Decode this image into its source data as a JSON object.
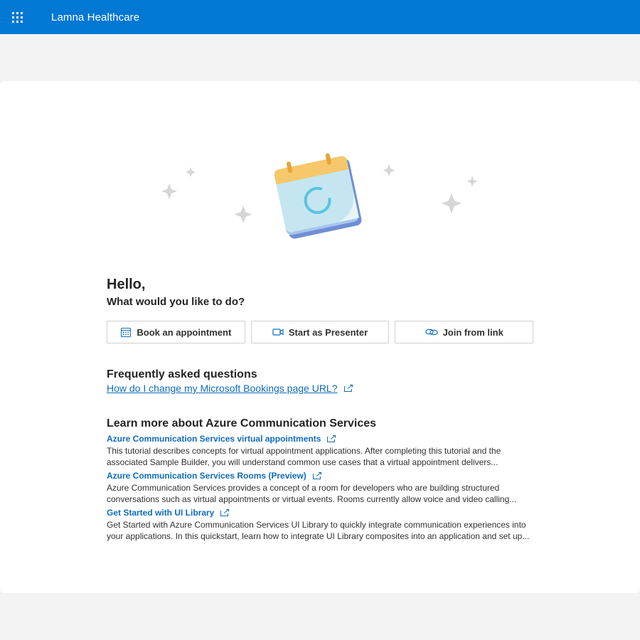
{
  "header": {
    "app_title": "Lamna Healthcare",
    "background": "#0078d4"
  },
  "main": {
    "greeting": "Hello,",
    "prompt": "What would you like to do?",
    "actions": [
      {
        "label": "Book an appointment",
        "icon": "calendar-icon"
      },
      {
        "label": "Start as Presenter",
        "icon": "video-camera-icon"
      },
      {
        "label": "Join from link",
        "icon": "link-icon"
      }
    ]
  },
  "faq": {
    "title": "Frequently asked questions",
    "link": "How do I change my Microsoft Bookings page URL?"
  },
  "learn_more": {
    "title": "Learn more about Azure Communication Services",
    "items": [
      {
        "title": "Azure Communication Services virtual appointments",
        "description": "This tutorial describes concepts for virtual appointment applications. After completing this tutorial and the associated Sample Builder, you will understand common use cases that a virtual appointment delivers..."
      },
      {
        "title": "Azure Communication Services Rooms (Preview)",
        "description": "Azure Communication Services provides a concept of a room for developers who are building structured conversations such as virtual appointments or virtual events. Rooms currently allow voice and video calling..."
      },
      {
        "title": "Get Started with UI Library",
        "description": "Get Started with Azure Communication Services UI Library to quickly integrate communication experiences into your applications. In this quickstart, learn how to integrate UI Library composites into an application and set up..."
      }
    ]
  },
  "colors": {
    "accent": "#0078d4",
    "link": "#0f6cbd",
    "page_background": "#f3f3f3"
  }
}
